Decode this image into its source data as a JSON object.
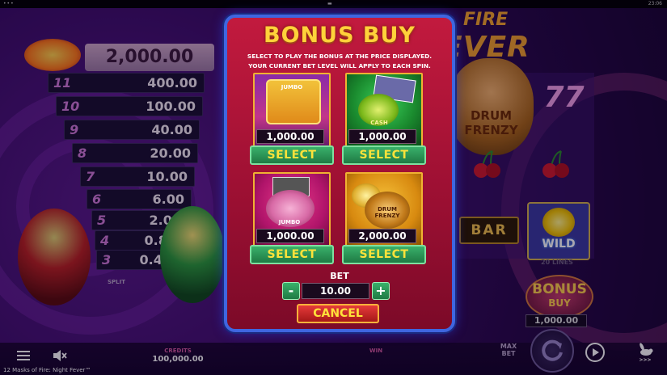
{
  "system": {
    "clock": "23:06"
  },
  "paytable": {
    "top_value": "2,000.00",
    "rows": [
      {
        "num": "11",
        "value": "400.00"
      },
      {
        "num": "10",
        "value": "100.00"
      },
      {
        "num": "9",
        "value": "40.00"
      },
      {
        "num": "8",
        "value": "20.00"
      },
      {
        "num": "7",
        "value": "10.00"
      },
      {
        "num": "6",
        "value": "6.00"
      },
      {
        "num": "5",
        "value": "2.00"
      },
      {
        "num": "4",
        "value": "0.80"
      },
      {
        "num": "3",
        "value": "0.40"
      }
    ],
    "provider_logo": "SPLIT"
  },
  "reels": {
    "logo_fire": "FIRE",
    "logo_fever": "EVER",
    "drum_frenzy": [
      "DRUM",
      "FRENZY"
    ],
    "bar": "BAR",
    "wild": "WILD",
    "lines": "20 LINES",
    "bonus_buy_button": {
      "line1": "BONUS",
      "line2": "BUY",
      "price": "1,000.00"
    }
  },
  "modal": {
    "title": "BONUS BUY",
    "description_line1": "SELECT TO PLAY THE BONUS AT THE PRICE DISPLAYED.",
    "description_line2": "YOUR CURRENT BET LEVEL WILL APPLY TO EACH SPIN.",
    "cards": [
      {
        "price": "1,000.00",
        "button": "SELECT",
        "art_label": "JUMBO"
      },
      {
        "price": "1,000.00",
        "button": "SELECT",
        "art_label": "CASH"
      },
      {
        "price": "1,000.00",
        "button": "SELECT",
        "art_label": "JUMBO"
      },
      {
        "price": "2,000.00",
        "button": "SELECT",
        "art_label": "DRUM FRENZY"
      }
    ],
    "bet_label": "BET",
    "bet_value": "10.00",
    "minus": "-",
    "plus": "+",
    "cancel": "CANCEL"
  },
  "bottom": {
    "credits_label": "CREDITS",
    "credits_value": "100,000.00",
    "win_label": "WIN",
    "max_bet": [
      "MAX",
      "BET"
    ],
    "turbo_label": ">>>",
    "game_title": "12 Masks of Fire: Night Fever™"
  }
}
